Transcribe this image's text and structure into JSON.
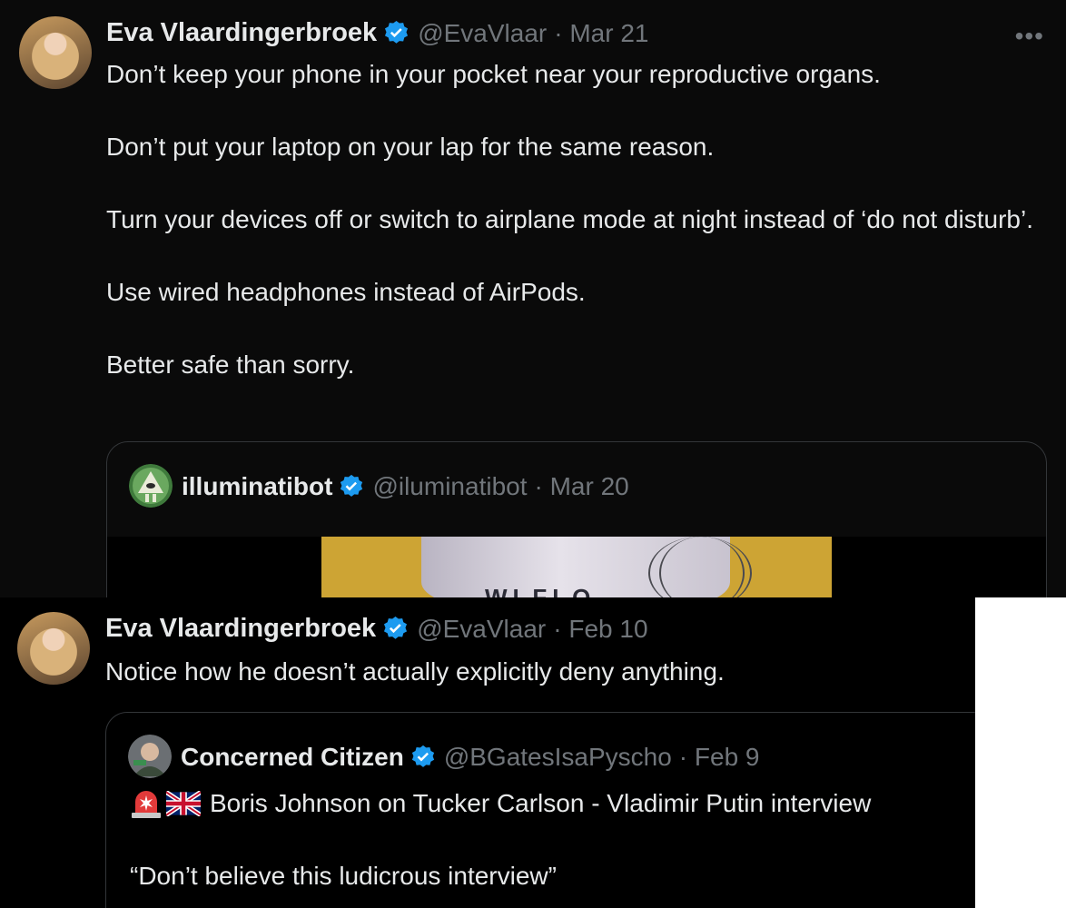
{
  "tweet1": {
    "author_name": "Eva Vlaardingerbroek",
    "handle": "@EvaVlaar",
    "date": "· Mar 21",
    "more_label": "•••",
    "text": "Don’t keep your phone in your pocket near your reproductive organs.\n\nDon’t put your laptop on your lap for the same reason.\n\nTurn your devices off or switch to airplane mode at night instead of ‘do not disturb’.\n\nUse wired headphones instead of AirPods.\n\nBetter safe than sorry.",
    "quote": {
      "author_name": "illuminatibot",
      "handle": "@iluminatibot",
      "date": "· Mar 20",
      "media_label": "WLFLO"
    }
  },
  "tweet2": {
    "author_name": "Eva Vlaardingerbroek",
    "handle": "@EvaVlaar",
    "date": "· Feb 10",
    "text": "Notice how he doesn’t actually explicitly deny anything.",
    "quote": {
      "author_name": "Concerned Citizen",
      "handle": "@BGatesIsaPyscho",
      "date": "· Feb 9",
      "line1": "Boris Johnson on Tucker Carlson - Vladimir Putin interview",
      "line2": "“Don’t believe this ludicrous interview”",
      "emoji_icons": [
        "siren-icon",
        "uk-flag-icon"
      ]
    }
  },
  "colors": {
    "background": "#0a0a0a",
    "text": "#e7e9ea",
    "muted": "#71767b",
    "verified": "#1d9bf0",
    "border": "#333639"
  }
}
